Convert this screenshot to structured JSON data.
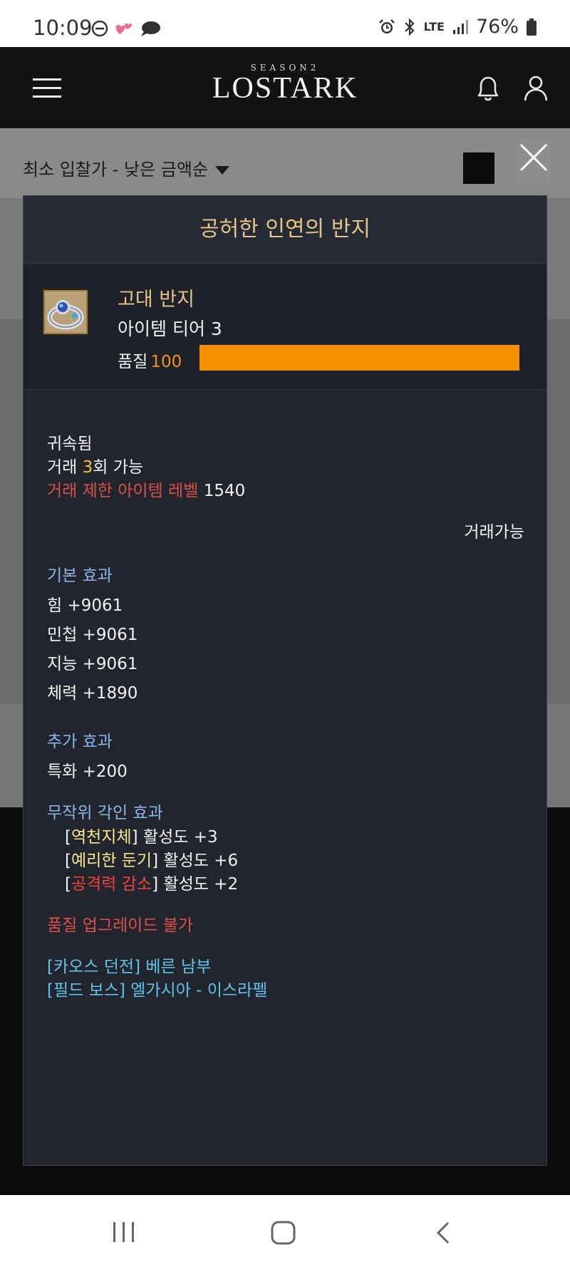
{
  "status_bar": {
    "time": "10:09",
    "network": "LTE",
    "battery": "76%"
  },
  "header": {
    "logo_season": "SEASON2",
    "logo_name": "LOSTARK"
  },
  "sort": {
    "label": "최소 입찰가 - 낮은 금액순"
  },
  "item": {
    "name": "공허한 인연의 반지",
    "grade": "고대 반지",
    "tier": "아이템 티어 3",
    "quality_label": "품질",
    "quality_value": "100",
    "quality_fraction": 1.0,
    "bound": "귀속됨",
    "trade_prefix": "거래 ",
    "trade_count": "3",
    "trade_suffix": "회 가능",
    "trade_limit_label": "거래 제한 아이템 레벨",
    "trade_limit_value": "1540",
    "tradable": "거래가능",
    "basic_effects_title": "기본 효과",
    "basic_effects": [
      "힘 +9061",
      "민첩 +9061",
      "지능 +9061",
      "체력 +1890"
    ],
    "extra_effects_title": "추가 효과",
    "extra_effects": [
      "특화 +200"
    ],
    "engravings_title": "무작위 각인 효과",
    "engravings": [
      {
        "name": "역천지체",
        "value": "활성도 +3",
        "color": "#f8e58c"
      },
      {
        "name": "예리한 둔기",
        "value": "활성도 +6",
        "color": "#f8e58c"
      },
      {
        "name": "공격력 감소",
        "value": "활성도 +2",
        "color": "#f0453b"
      }
    ],
    "upgrade_note": "품질 업그레이드 불가",
    "sources": [
      "[카오스 던전] 베른 남부",
      "[필드 보스] 엘가시아 - 이스라펠"
    ]
  },
  "colors": {
    "accent_gold": "#e5c48a",
    "quality_orange": "#f79000",
    "section_blue": "#8db6e8",
    "warning_red": "#d9504a",
    "source_cyan": "#5ec4e8"
  }
}
